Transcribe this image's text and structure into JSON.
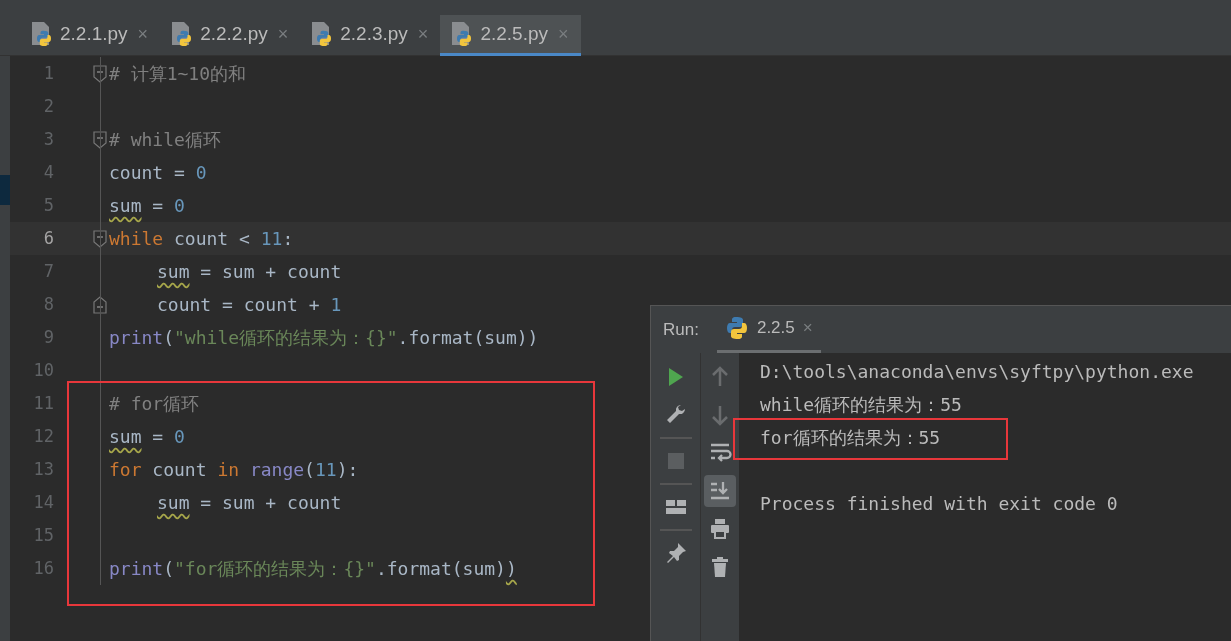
{
  "tabs": [
    {
      "label": "2.2.1.py",
      "close": "×",
      "selected": false
    },
    {
      "label": "2.2.2.py",
      "close": "×",
      "selected": false
    },
    {
      "label": "2.2.3.py",
      "close": "×",
      "selected": false
    },
    {
      "label": "2.2.5.py",
      "close": "×",
      "selected": true
    }
  ],
  "editor": {
    "lines": [
      {
        "number": "1",
        "current": false,
        "fold_start": true,
        "tokens": [
          {
            "kind": "comment",
            "text": "# 计算1~10的和"
          }
        ]
      },
      {
        "number": "2",
        "current": false
      },
      {
        "number": "3",
        "current": false,
        "fold_start": true,
        "tokens": [
          {
            "kind": "comment",
            "text": "# while循环"
          }
        ]
      },
      {
        "number": "4",
        "current": false,
        "tokens": [
          {
            "kind": "plain",
            "text": "count = "
          },
          {
            "kind": "number",
            "text": "0"
          }
        ]
      },
      {
        "number": "5",
        "current": false,
        "tokens": [
          {
            "kind": "warn",
            "text": "sum"
          },
          {
            "kind": "plain",
            "text": " = "
          },
          {
            "kind": "number",
            "text": "0"
          }
        ]
      },
      {
        "number": "6",
        "current": true,
        "fold_start": true,
        "tokens": [
          {
            "kind": "keyword",
            "text": "while"
          },
          {
            "kind": "plain",
            "text": " count < "
          },
          {
            "kind": "number",
            "text": "11"
          },
          {
            "kind": "plain",
            "text": ":"
          }
        ]
      },
      {
        "number": "7",
        "current": false,
        "indented": true,
        "tokens": [
          {
            "kind": "warn",
            "text": "sum"
          },
          {
            "kind": "plain",
            "text": " = sum + count"
          }
        ]
      },
      {
        "number": "8",
        "current": false,
        "fold_end": true,
        "indented": true,
        "tokens": [
          {
            "kind": "plain",
            "text": "count = count + "
          },
          {
            "kind": "number",
            "text": "1"
          }
        ]
      },
      {
        "number": "9",
        "current": false,
        "tokens": [
          {
            "kind": "builtin",
            "text": "print"
          },
          {
            "kind": "plain",
            "text": "("
          },
          {
            "kind": "string",
            "text": "\"while循环的结果为：{}\""
          },
          {
            "kind": "plain",
            "text": ".format(sum))"
          }
        ]
      },
      {
        "number": "10",
        "current": false
      },
      {
        "number": "11",
        "current": false,
        "tokens": [
          {
            "kind": "comment",
            "text": "# for循环"
          }
        ]
      },
      {
        "number": "12",
        "current": false,
        "tokens": [
          {
            "kind": "warn",
            "text": "sum"
          },
          {
            "kind": "plain",
            "text": " = "
          },
          {
            "kind": "number",
            "text": "0"
          }
        ]
      },
      {
        "number": "13",
        "current": false,
        "tokens": [
          {
            "kind": "keyword",
            "text": "for"
          },
          {
            "kind": "plain",
            "text": " count "
          },
          {
            "kind": "keyword",
            "text": "in"
          },
          {
            "kind": "builtin",
            "text": " range"
          },
          {
            "kind": "plain",
            "text": "("
          },
          {
            "kind": "number",
            "text": "11"
          },
          {
            "kind": "plain",
            "text": "):"
          }
        ]
      },
      {
        "number": "14",
        "current": false,
        "indented": true,
        "tokens": [
          {
            "kind": "warn",
            "text": "sum"
          },
          {
            "kind": "plain",
            "text": " = sum + count"
          }
        ]
      },
      {
        "number": "15",
        "current": false
      },
      {
        "number": "16",
        "current": false,
        "tokens": [
          {
            "kind": "builtin",
            "text": "print"
          },
          {
            "kind": "plain",
            "text": "("
          },
          {
            "kind": "string",
            "text": "\"for循环的结果为：{}\""
          },
          {
            "kind": "plain",
            "text": ".format(sum)"
          },
          {
            "kind": "warn",
            "text": ")"
          }
        ]
      }
    ]
  },
  "run_panel": {
    "label": "Run:",
    "tab": {
      "label": "2.2.5",
      "close": "×",
      "selected": true
    },
    "left_tools": [
      {
        "kind": "run",
        "disabled": false
      },
      {
        "kind": "wrench",
        "disabled": false
      },
      {
        "kind": "stop",
        "disabled": true
      },
      {
        "kind": "layout",
        "disabled": false
      },
      {
        "kind": "pin",
        "disabled": false
      }
    ],
    "right_tools": [
      {
        "kind": "up",
        "disabled": true,
        "selected": false
      },
      {
        "kind": "down",
        "disabled": true,
        "selected": false
      },
      {
        "kind": "wrap",
        "disabled": false,
        "selected": false
      },
      {
        "kind": "scroll-end",
        "disabled": false,
        "selected": true
      },
      {
        "kind": "print",
        "disabled": false,
        "selected": false
      },
      {
        "kind": "trash",
        "disabled": false,
        "selected": false
      }
    ],
    "console": [
      {
        "text": "D:\\tools\\anaconda\\envs\\syftpy\\python.exe",
        "blank_before": false
      },
      {
        "text": "while循环的结果为：55",
        "blank_before": false
      },
      {
        "text": "for循环的结果为：55",
        "blank_before": false
      },
      {
        "text": "Process finished with exit code 0",
        "blank_before": true
      }
    ]
  }
}
